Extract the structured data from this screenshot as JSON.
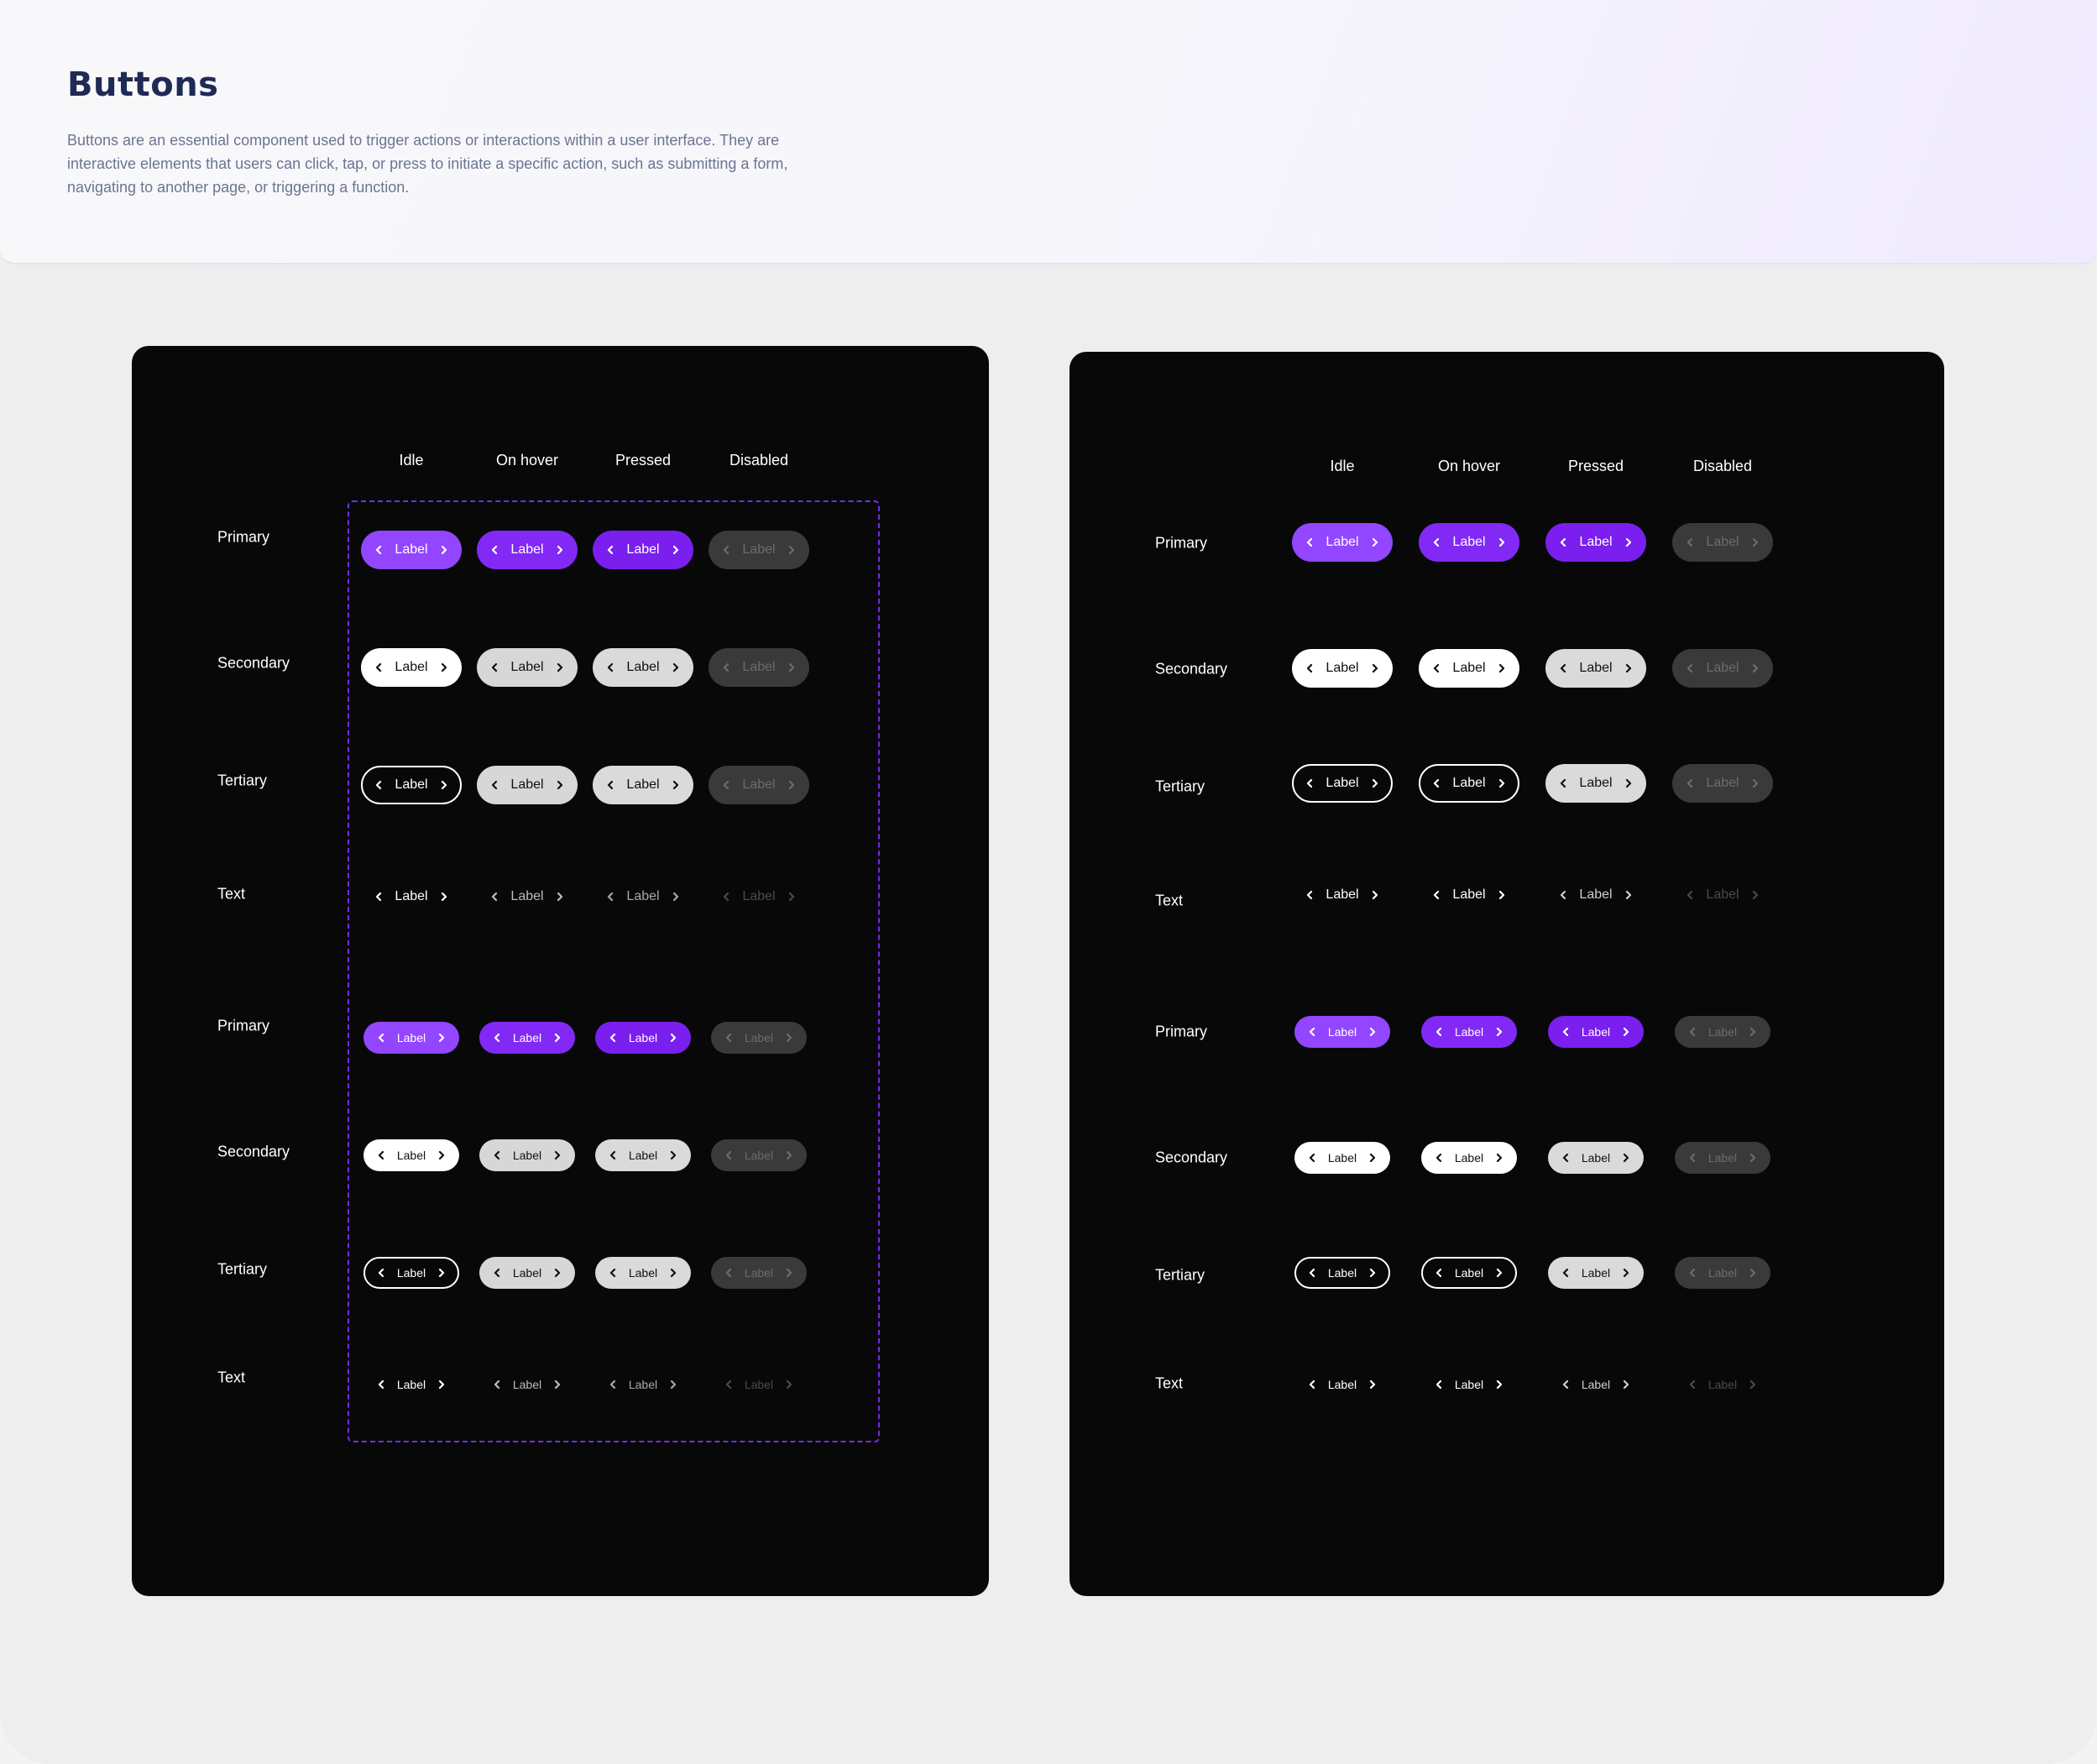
{
  "header": {
    "title": "Buttons",
    "description": "Buttons are an essential component used to trigger actions or interactions within a user interface. They are interactive elements that users can click, tap, or press to initiate a specific action, such as submitting a form, navigating to another page, or triggering a function."
  },
  "states": [
    "Idle",
    "On hover",
    "Pressed",
    "Disabled"
  ],
  "variants": [
    "Primary",
    "Secondary",
    "Tertiary",
    "Text"
  ],
  "button_label": "Label",
  "colors": {
    "primary": "#9346ff",
    "primary_pressed": "#7a1fee",
    "panel_bg": "#080808",
    "disabled_bg": "#3a3a3a",
    "dash_border": "#6f2fe6"
  },
  "icons": {
    "leading": "chevron-left-icon",
    "trailing": "chevron-right-icon"
  }
}
